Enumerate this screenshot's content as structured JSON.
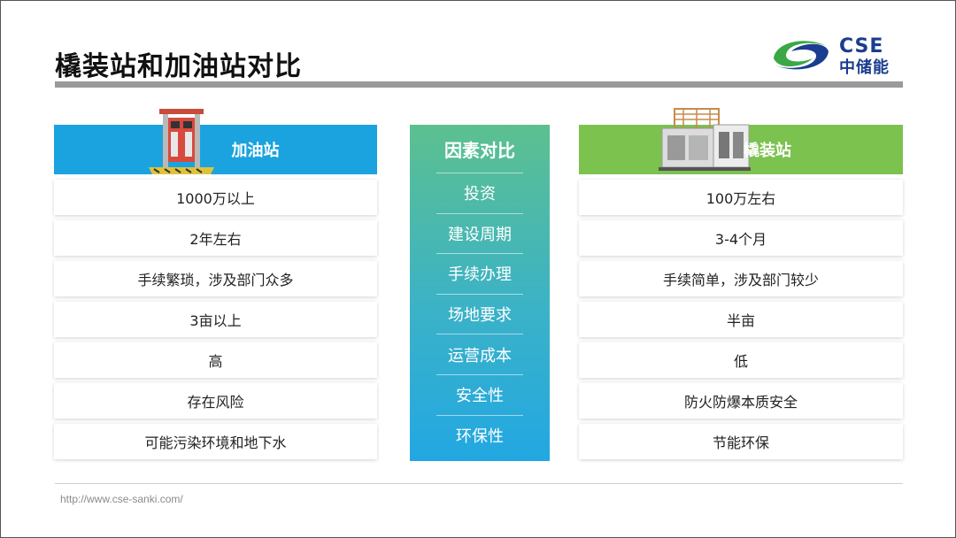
{
  "slide": {
    "title": "橇装站和加油站对比",
    "footer_url": "http://www.cse-sanki.com/"
  },
  "logo": {
    "text_en": "CSE",
    "text_cn": "中储能",
    "colors": {
      "blue": "#1a3d8f",
      "green": "#3aa845"
    }
  },
  "left": {
    "header": "加油站",
    "header_color": "#1aa3df",
    "image_icon": "fuel-station-image",
    "rows": [
      "1000万以上",
      "2年左右",
      "手续繁琐，涉及部门众多",
      "3亩以上",
      "高",
      "存在风险",
      "可能污染环境和地下水"
    ]
  },
  "center": {
    "header": "因素对比",
    "items": [
      "投资",
      "建设周期",
      "手续办理",
      "场地要求",
      "运营成本",
      "安全性",
      "环保性"
    ]
  },
  "right": {
    "header": "橇装站",
    "header_color": "#7bc24e",
    "image_icon": "skid-station-image",
    "rows": [
      "100万左右",
      "3-4个月",
      "手续简单，涉及部门较少",
      "半亩",
      "低",
      "防火防爆本质安全",
      "节能环保"
    ]
  }
}
